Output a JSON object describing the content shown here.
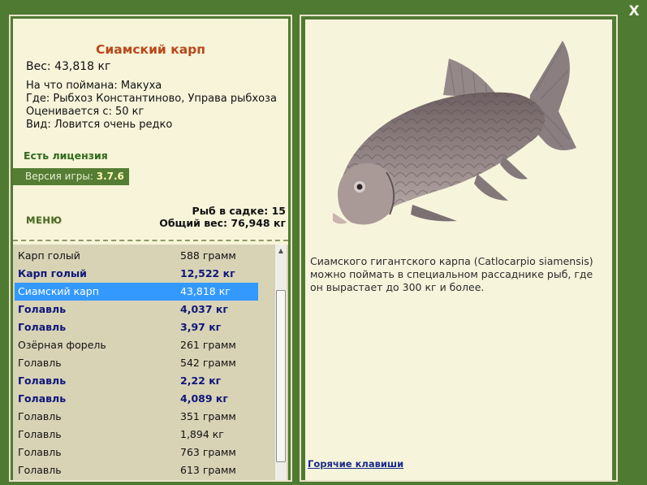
{
  "close_label": "X",
  "fish": {
    "title": "Сиамский карп",
    "weight": "Вес: 43,818 кг",
    "bait": "На что поймана: Макуха",
    "location": "Где: Рыбхоз Константиново, Управа рыбхоза",
    "value": "Оценивается с: 50 кг",
    "kind": "Вид: Ловится очень редко"
  },
  "license": "Есть лицензия",
  "version": {
    "label": "Версия игры:",
    "value": "3.7.6"
  },
  "menu_label": "МЕНЮ",
  "stats": {
    "count": "Рыб в садке: 15",
    "total_weight": "Общий вес: 76,948 кг"
  },
  "catch_list": [
    {
      "name": "Карп голый",
      "weight": "588 грамм",
      "trophy": false,
      "selected": false
    },
    {
      "name": "Карп голый",
      "weight": "12,522 кг",
      "trophy": true,
      "selected": false
    },
    {
      "name": "Сиамский карп",
      "weight": "43,818 кг",
      "trophy": false,
      "selected": true
    },
    {
      "name": "Голавль",
      "weight": "4,037 кг",
      "trophy": true,
      "selected": false
    },
    {
      "name": "Голавль",
      "weight": "3,97 кг",
      "trophy": true,
      "selected": false
    },
    {
      "name": "Озёрная форель",
      "weight": "261 грамм",
      "trophy": false,
      "selected": false
    },
    {
      "name": "Голавль",
      "weight": "542 грамм",
      "trophy": false,
      "selected": false
    },
    {
      "name": "Голавль",
      "weight": "2,22 кг",
      "trophy": true,
      "selected": false
    },
    {
      "name": "Голавль",
      "weight": "4,089 кг",
      "trophy": true,
      "selected": false
    },
    {
      "name": "Голавль",
      "weight": "351 грамм",
      "trophy": false,
      "selected": false
    },
    {
      "name": "Голавль",
      "weight": "1,894 кг",
      "trophy": false,
      "selected": false
    },
    {
      "name": "Голавль",
      "weight": "763 грамм",
      "trophy": false,
      "selected": false
    },
    {
      "name": "Голавль",
      "weight": "613 грамм",
      "trophy": false,
      "selected": false
    }
  ],
  "description": "Сиамского гигантского карпа (Catlocarpio siamensis) можно поймать в специальном рассаднике рыб, где он вырастает до 300 кг и более.",
  "hotkeys_label": "Горячие клавиши",
  "colors": {
    "background": "#4f7a32",
    "panel": "#f7f4d9",
    "title": "#b8481a",
    "license": "#2f6b1c",
    "trophy": "#10177a",
    "selected": "#3399ff",
    "list_bg": "#d8d3b5"
  },
  "icons": {
    "close": "close-icon",
    "scroll_up": "arrow-up-icon",
    "fish_picture": "siamese-carp-image"
  }
}
